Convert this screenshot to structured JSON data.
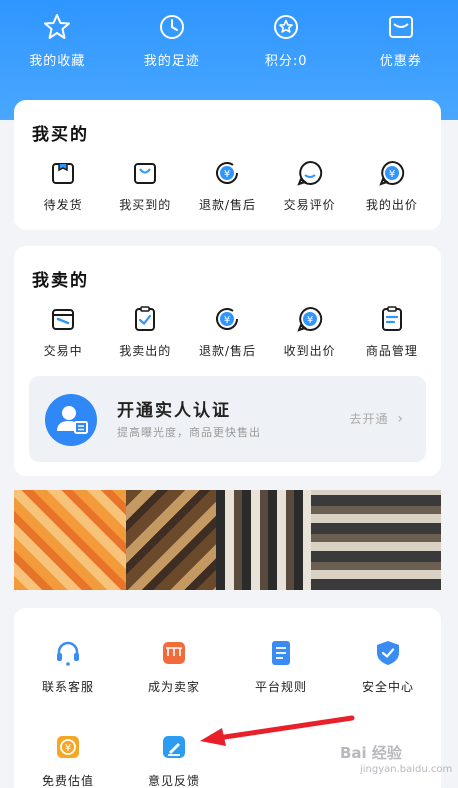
{
  "top": {
    "items": [
      {
        "label": "我的收藏",
        "icon": "star-icon"
      },
      {
        "label": "我的足迹",
        "icon": "clock-icon"
      },
      {
        "label": "积分:0",
        "icon": "points-icon"
      },
      {
        "label": "优惠券",
        "icon": "coupon-icon"
      }
    ]
  },
  "buy": {
    "title": "我买的",
    "items": [
      {
        "label": "待发货",
        "icon": "package-icon"
      },
      {
        "label": "我买到的",
        "icon": "shopping-bag-icon"
      },
      {
        "label": "退款/售后",
        "icon": "refund-icon"
      },
      {
        "label": "交易评价",
        "icon": "comment-icon"
      },
      {
        "label": "我的出价",
        "icon": "bid-icon"
      }
    ]
  },
  "sell": {
    "title": "我卖的",
    "items": [
      {
        "label": "交易中",
        "icon": "wallet-icon"
      },
      {
        "label": "我卖出的",
        "icon": "clipboard-check-icon"
      },
      {
        "label": "退款/售后",
        "icon": "refund-icon"
      },
      {
        "label": "收到出价",
        "icon": "bid-icon"
      },
      {
        "label": "商品管理",
        "icon": "clipboard-list-icon"
      }
    ]
  },
  "verify": {
    "title": "开通实人认证",
    "subtitle": "提高曝光度，商品更快售出",
    "link": "去开通"
  },
  "tools": {
    "items": [
      {
        "label": "联系客服",
        "icon": "headset-icon",
        "color": "#3b8cf2"
      },
      {
        "label": "成为卖家",
        "icon": "store-icon",
        "color": "#f26b3a"
      },
      {
        "label": "平台规则",
        "icon": "document-icon",
        "color": "#3b8cf2"
      },
      {
        "label": "安全中心",
        "icon": "shield-check-icon",
        "color": "#3b8cf2"
      },
      {
        "label": "免费估值",
        "icon": "valuation-icon",
        "color": "#f5a623"
      },
      {
        "label": "意见反馈",
        "icon": "edit-icon",
        "color": "#2b9cf2"
      }
    ]
  },
  "watermark": {
    "main": "Bai 经验",
    "sub": "jingyan.baidu.com"
  }
}
